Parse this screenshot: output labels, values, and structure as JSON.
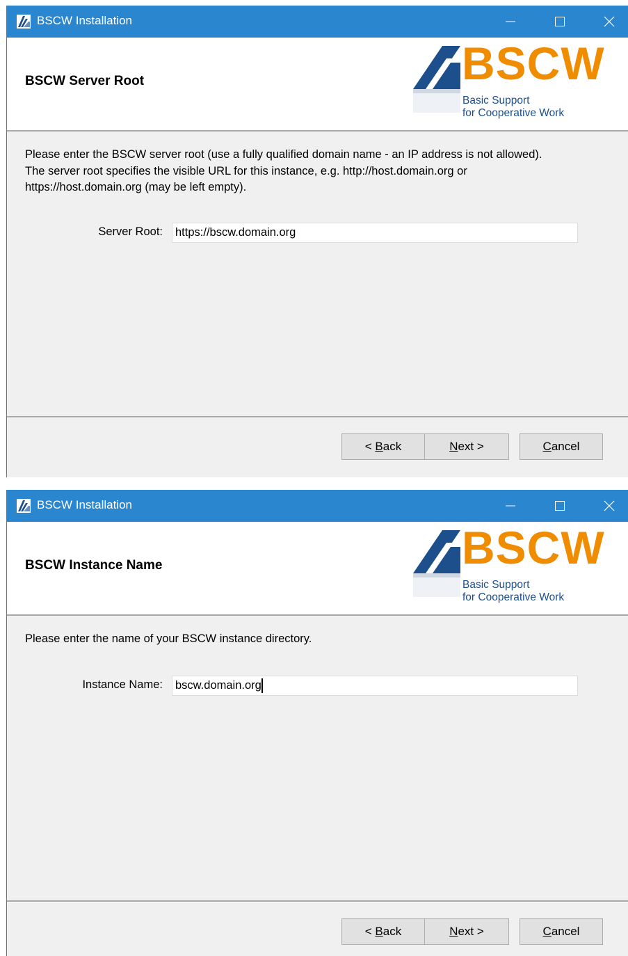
{
  "windows": [
    {
      "title": "BSCW Installation",
      "header_title": "BSCW Server Root",
      "logo": {
        "word": "BSCW",
        "tagline_1": "Basic Support",
        "tagline_2": "for Cooperative Work"
      },
      "description_lines": [
        "Please enter the BSCW server root (use a fully qualified domain name - an IP address is not allowed).",
        "The server root specifies the visible URL for this instance, e.g. http://host.domain.org or",
        "https://host.domain.org (may be left empty)."
      ],
      "field": {
        "label": "Server Root:",
        "value": "https://bscw.domain.org"
      },
      "buttons": {
        "back": {
          "pre": "< ",
          "mnemonic": "B",
          "rest": "ack"
        },
        "next": {
          "mnemonic": "N",
          "rest": "ext >"
        },
        "cancel": {
          "mnemonic": "C",
          "rest": "ancel"
        }
      }
    },
    {
      "title": "BSCW Installation",
      "header_title": "BSCW Instance Name",
      "logo": {
        "word": "BSCW",
        "tagline_1": "Basic Support",
        "tagline_2": "for Cooperative Work"
      },
      "description_lines": [
        "Please enter the name of your BSCW instance directory."
      ],
      "field": {
        "label": "Instance Name:",
        "value": "bscw.domain.org"
      },
      "buttons": {
        "back": {
          "pre": "< ",
          "mnemonic": "B",
          "rest": "ack"
        },
        "next": {
          "mnemonic": "N",
          "rest": "ext >"
        },
        "cancel": {
          "mnemonic": "C",
          "rest": "ancel"
        }
      }
    }
  ],
  "colors": {
    "titlebar": "#2b86d0",
    "logo_orange": "#f08c00",
    "logo_blue": "#1d4f8c",
    "window_bg": "#f0f0f0"
  },
  "icons": {
    "app": "bscw-app-icon",
    "minimize": "minimize-icon",
    "maximize": "maximize-icon",
    "close": "close-icon"
  }
}
